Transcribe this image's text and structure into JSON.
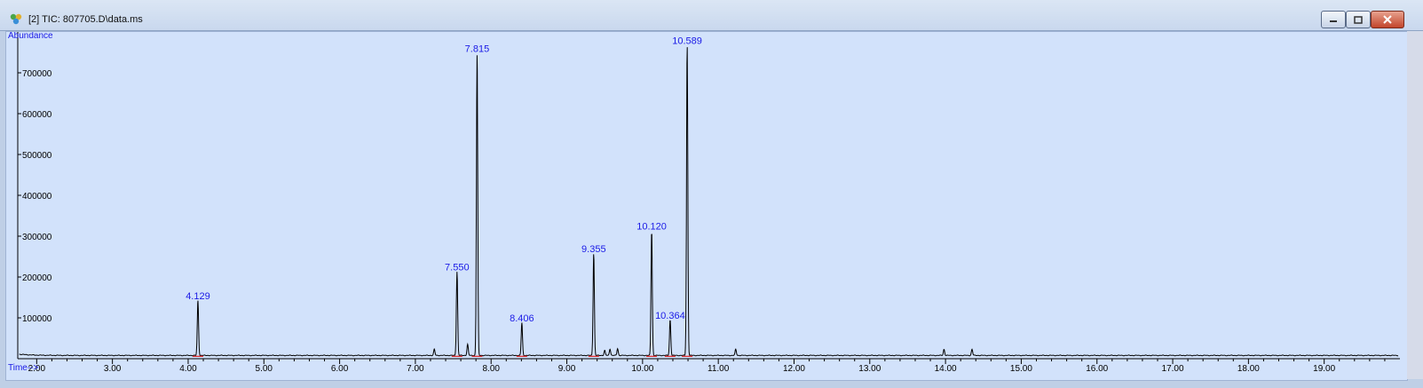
{
  "window": {
    "title": "[2] TIC: 807705.D\\data.ms",
    "icon": "chemstation-app-icon",
    "controls": [
      "minimize-icon",
      "maximize-icon",
      "close-icon"
    ]
  },
  "colors": {
    "background": "#d2e2fb",
    "trace": "#000000",
    "labels": "#1a1ae6",
    "baseline": "#e02020"
  },
  "chart_data": {
    "type": "line",
    "title": "",
    "ylabel": "Abundance",
    "xlabel": "Time-->",
    "xlim": [
      1.75,
      20.0
    ],
    "ylim": [
      0,
      800000
    ],
    "x_ticks": [
      "2.00",
      "3.00",
      "4.00",
      "5.00",
      "6.00",
      "7.00",
      "8.00",
      "9.00",
      "10.00",
      "11.00",
      "12.00",
      "13.00",
      "14.00",
      "15.00",
      "16.00",
      "17.00",
      "18.00",
      "19.00"
    ],
    "y_ticks": [
      "100000",
      "200000",
      "300000",
      "400000",
      "500000",
      "600000",
      "700000"
    ],
    "baseline": 8000,
    "peaks": [
      {
        "rt": 4.129,
        "height": 135000,
        "label": "4.129"
      },
      {
        "rt": 7.25,
        "height": 15000,
        "label": ""
      },
      {
        "rt": 7.55,
        "height": 205000,
        "label": "7.550"
      },
      {
        "rt": 7.69,
        "height": 27000,
        "label": ""
      },
      {
        "rt": 7.815,
        "height": 740000,
        "label": "7.815"
      },
      {
        "rt": 8.406,
        "height": 80000,
        "label": "8.406"
      },
      {
        "rt": 9.355,
        "height": 250000,
        "label": "9.355"
      },
      {
        "rt": 9.5,
        "height": 12000,
        "label": ""
      },
      {
        "rt": 9.57,
        "height": 16000,
        "label": ""
      },
      {
        "rt": 9.67,
        "height": 17000,
        "label": ""
      },
      {
        "rt": 10.12,
        "height": 305000,
        "label": "10.120"
      },
      {
        "rt": 10.364,
        "height": 87000,
        "label": "10.364"
      },
      {
        "rt": 10.589,
        "height": 760000,
        "label": "10.589"
      },
      {
        "rt": 11.23,
        "height": 15000,
        "label": ""
      },
      {
        "rt": 13.98,
        "height": 15000,
        "label": ""
      },
      {
        "rt": 14.35,
        "height": 15000,
        "label": ""
      }
    ]
  }
}
